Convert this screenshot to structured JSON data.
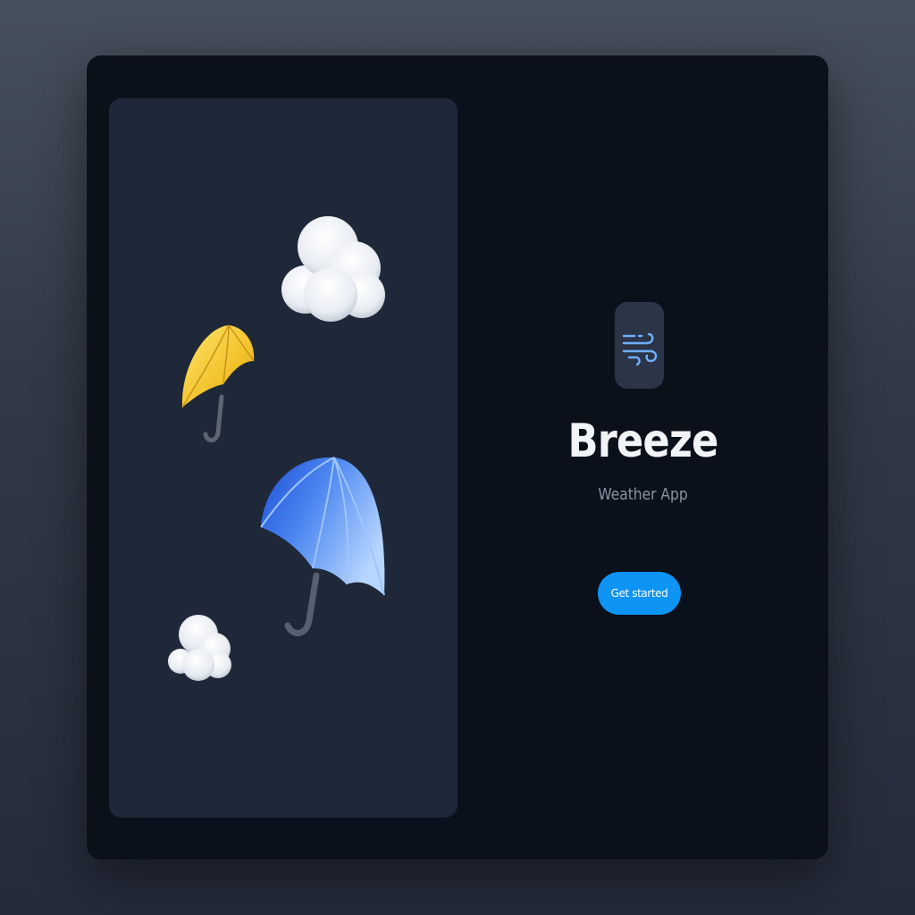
{
  "app": {
    "name": "Breeze",
    "subtitle": "Weather App",
    "icon": "wind-icon"
  },
  "actions": {
    "primary_label": "Get started"
  },
  "illustration": {
    "items": [
      "cloud-icon",
      "yellow-umbrella-icon",
      "blue-umbrella-icon",
      "cloud-icon"
    ]
  },
  "colors": {
    "background": "#0b111b",
    "panel": "#1f2838",
    "accent": "#0d94f4",
    "title": "#f1f3f6",
    "subtitle": "#8b93a1"
  }
}
